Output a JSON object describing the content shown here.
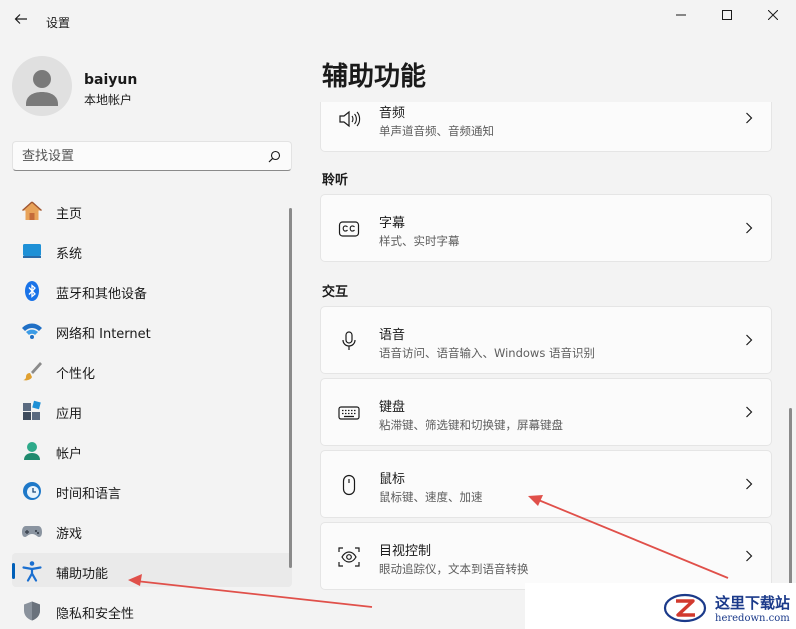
{
  "app": {
    "title": "设置"
  },
  "profile": {
    "name": "baiyun",
    "account_type": "本地帐户"
  },
  "search": {
    "placeholder": "查找设置"
  },
  "nav": {
    "items": [
      {
        "label": "主页",
        "icon": "home-icon"
      },
      {
        "label": "系统",
        "icon": "system-icon"
      },
      {
        "label": "蓝牙和其他设备",
        "icon": "bluetooth-icon"
      },
      {
        "label": "网络和 Internet",
        "icon": "wifi-icon"
      },
      {
        "label": "个性化",
        "icon": "brush-icon"
      },
      {
        "label": "应用",
        "icon": "apps-icon"
      },
      {
        "label": "帐户",
        "icon": "account-icon"
      },
      {
        "label": "时间和语言",
        "icon": "clock-globe-icon"
      },
      {
        "label": "游戏",
        "icon": "gamepad-icon"
      },
      {
        "label": "辅助功能",
        "icon": "accessibility-icon",
        "active": true
      },
      {
        "label": "隐私和安全性",
        "icon": "shield-icon"
      }
    ]
  },
  "main": {
    "title": "辅助功能",
    "audio_card": {
      "title": "音频",
      "subtitle": "单声道音频、音频通知"
    },
    "section_hearing": "聆听",
    "captions_card": {
      "title": "字幕",
      "subtitle": "样式、实时字幕"
    },
    "section_interaction": "交互",
    "speech_card": {
      "title": "语音",
      "subtitle": "语音访问、语音输入、Windows 语音识别"
    },
    "keyboard_card": {
      "title": "键盘",
      "subtitle": "粘滞键、筛选键和切换键，屏幕键盘"
    },
    "mouse_card": {
      "title": "鼠标",
      "subtitle": "鼠标键、速度、加速"
    },
    "eye_card": {
      "title": "目视控制",
      "subtitle": "眼动追踪仪，文本到语音转换"
    }
  },
  "watermark": {
    "text": "这里下载站",
    "url": "heredown.com"
  },
  "colors": {
    "accent": "#005fb8",
    "annotation_arrow": "#e0504a",
    "background": "#f3f3f3"
  }
}
